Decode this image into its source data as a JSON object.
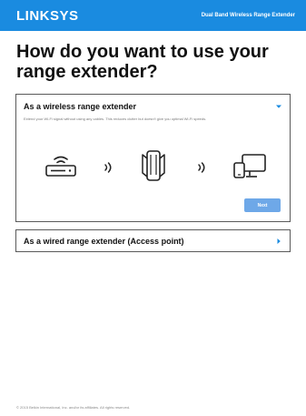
{
  "header": {
    "logo": "LINKSYS",
    "product": "Dual Band Wireless Range Extender"
  },
  "page_title": "How do you want to use your range extender?",
  "options": [
    {
      "title": "As a wireless range extender",
      "description": "Extend your Wi-Fi signal without using any cables. This reduces clutter but doesn't give you optimal Wi-Fi speeds.",
      "expanded": true,
      "button_label": "Next",
      "diagram_icons": [
        "router-icon",
        "wifi-waves-icon",
        "extender-icon",
        "wifi-waves-icon",
        "devices-icon"
      ]
    },
    {
      "title": "As a wired range extender (Access point)",
      "expanded": false
    }
  ],
  "footer": "© 2015 Belkin International, Inc. and/or its affiliates. All rights reserved.",
  "colors": {
    "brand_blue": "#1a8be0",
    "button_blue": "#6ea8e8",
    "chevron_blue": "#1a8be0"
  }
}
